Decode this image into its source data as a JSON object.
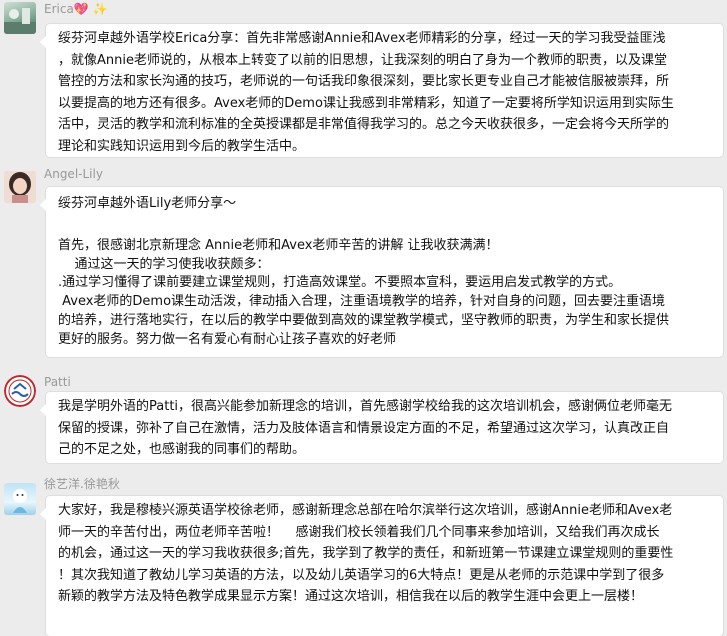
{
  "messages": [
    {
      "name": "Erica💖 ✨",
      "lines": [
        "绥芬河卓越外语学校Erica分享：首先非常感谢Annie和Avex老师精彩的分享，经过一天的学习我受益匪浅",
        "，就像Annie老师说的，从根本上转变了以前的旧思想，让我深刻的明白了身为一个教师的职责，以及课堂",
        "管控的方法和家长沟通的技巧，老师说的一句话我印象很深刻，要比家长更专业自己才能被信服被崇拜，所",
        "以要提高的地方还有很多。Avex老师的Demo课让我感到非常精彩，知道了一定要将所学知识运用到实际生",
        "活中，灵活的教学和流利标准的全英授课都是非常值得我学习的。总之今天收获很多，一定会将今天所学的",
        "理论和实践知识运用到今后的教学生活中。"
      ]
    },
    {
      "name": "Angel-Lily",
      "lines": [
        "绥芬河卓越外语Lily老师分享～",
        "",
        "首先，很感谢北京新理念 Annie老师和Avex老师辛苦的讲解 让我收获满满！",
        "    通过这一天的学习使我收获颇多：",
        ".通过学习懂得了课前要建立课堂规则，打造高效课堂。不要照本宣科，要运用启发式教学的方式。",
        " Avex老师的Demo课生动活泼，律动插入合理，注重语境教学的培养，针对自身的问题，回去要注重语境",
        "的培养，进行落地实行，在以后的教学中要做到高效的课堂教学模式，坚守教师的职责，为学生和家长提供",
        "更好的服务。努力做一名有爱心有耐心让孩子喜欢的好老师"
      ]
    },
    {
      "name": "Patti",
      "lines": [
        "我是学明外语的Patti，很高兴能参加新理念的培训，首先感谢学校给我的这次培训机会，感谢俩位老师毫无",
        "保留的授课，弥补了自己在激情，活力及肢体语言和情景设定方面的不足，希望通过这次学习，认真改正自",
        "己的不足之处，也感谢我的同事们的帮助。"
      ]
    },
    {
      "name": "徐艺洋.徐艳秋",
      "lines": [
        "大家好，我是穆棱兴源英语学校徐老师，感谢新理念总部在哈尔滨举行这次培训，感谢Annie老师和Avex老",
        "师一天的辛苦付出，两位老师辛苦啦！    感谢我们校长领着我们几个同事来参加培训，又给我们再次成长",
        "的机会，通过这一天的学习我收获很多;首先，我学到了教学的责任，和新班第一节课建立课堂规则的重要性",
        "！其次我知道了教幼儿学习英语的方法，以及幼儿英语学习的6大特点！更是从老师的示范课中学到了很多",
        "新颖的教学方法及特色教学成果显示方案！通过这次培训，相信我在以后的教学生涯中会更上一层楼！"
      ]
    }
  ]
}
